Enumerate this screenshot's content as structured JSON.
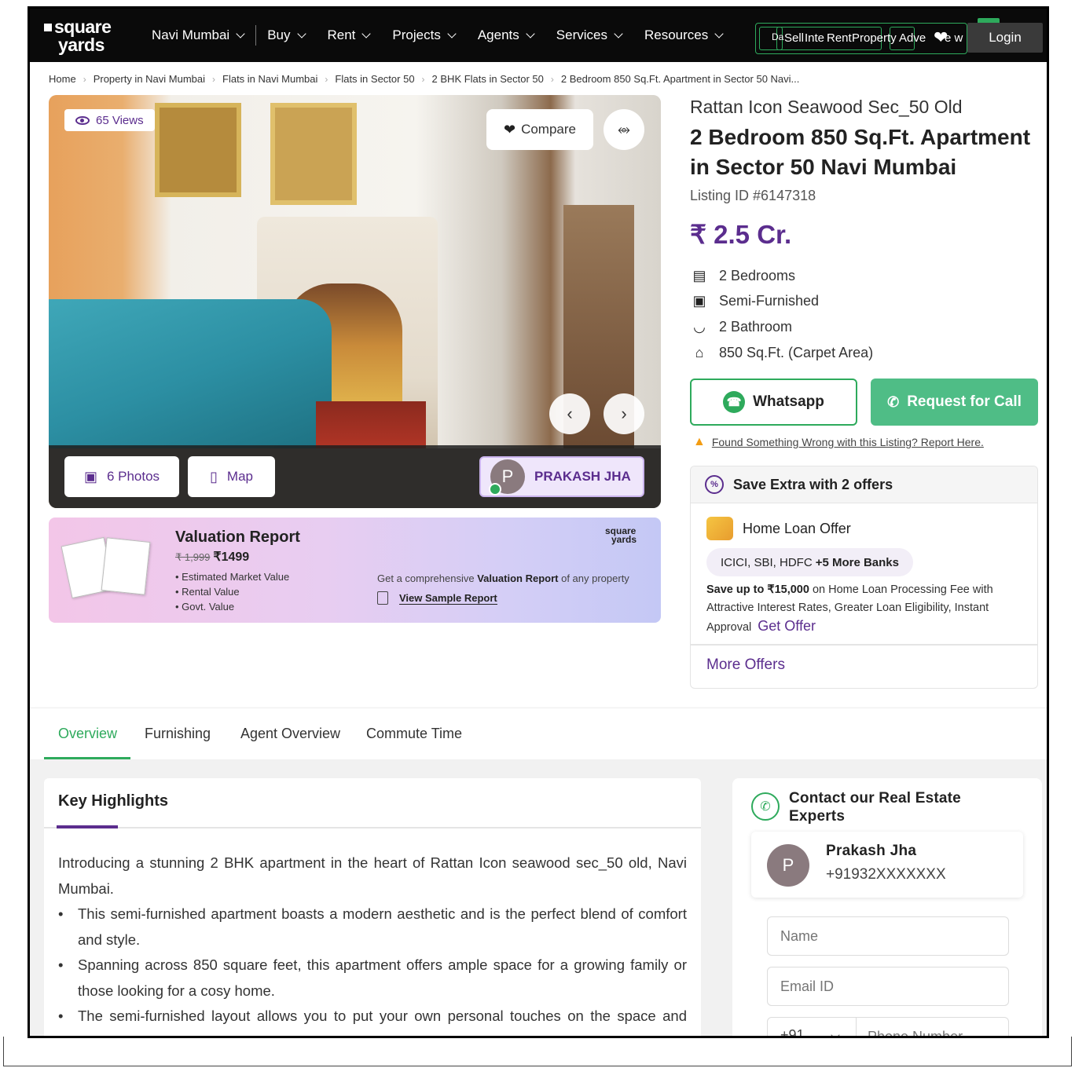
{
  "navbar": {
    "logo_line1": "square",
    "logo_line2": "yards",
    "items": [
      {
        "label": "Navi Mumbai"
      },
      {
        "label": "Buy"
      },
      {
        "label": "Rent"
      },
      {
        "label": "Projects"
      },
      {
        "label": "Agents"
      },
      {
        "label": "Services"
      },
      {
        "label": "Resources"
      }
    ],
    "cluster_labels": [
      "Da",
      "Sell",
      "Inte",
      "Rent",
      "Property",
      "Adve",
      "e w"
    ],
    "login_label": "Login"
  },
  "breadcrumb": [
    "Home",
    "Property in Navi Mumbai",
    "Flats in Navi Mumbai",
    "Flats in Sector 50",
    "2 BHK Flats in Sector 50",
    "2 Bedroom 850 Sq.Ft. Apartment in Sector 50 Navi..."
  ],
  "gallery": {
    "views": "65 Views",
    "compare_label": "Compare",
    "photos_label": "6 Photos",
    "map_label": "Map",
    "agent_initial": "P",
    "agent_name": "PRAKASH JHA"
  },
  "valuation": {
    "title": "Valuation Report",
    "old_price": "₹ 1,999",
    "price": "₹1499",
    "points": [
      "Estimated Market Value",
      "Rental Value",
      "Govt. Value"
    ],
    "desc_pre": "Get a comprehensive ",
    "desc_bold": "Valuation Report",
    "desc_post": " of any property",
    "link": "View Sample Report",
    "brand_line1": "square",
    "brand_line2": "yards"
  },
  "property": {
    "project": "Rattan Icon Seawood Sec_50 Old",
    "title": "2 Bedroom 850 Sq.Ft. Apartment in Sector 50 Navi Mumbai",
    "listing_id": "Listing ID #6147318",
    "price": "₹ 2.5 Cr.",
    "features": [
      {
        "icon": "bed-icon",
        "label": "2 Bedrooms"
      },
      {
        "icon": "sofa-icon",
        "label": "Semi-Furnished"
      },
      {
        "icon": "bathtub-icon",
        "label": "2 Bathroom"
      },
      {
        "icon": "home-icon",
        "label": "850 Sq.Ft. (Carpet Area)"
      }
    ],
    "whatsapp_label": "Whatsapp",
    "call_label": "Request for Call",
    "report_text": "Found Something Wrong with this Listing? Report Here."
  },
  "offers": {
    "heading": "Save Extra with 2 offers",
    "loan_title": "Home Loan Offer",
    "banks": "ICICI, SBI, HDFC",
    "banks_more": "+5 More Banks",
    "desc_bold": "Save up to ₹15,000",
    "desc_rest": " on Home Loan Processing Fee with Attractive Interest Rates, Greater Loan Eligibility, Instant Approval",
    "get_offer": "Get Offer",
    "more_offers": "More Offers"
  },
  "tabs": [
    "Overview",
    "Furnishing",
    "Agent Overview",
    "Commute Time"
  ],
  "highlights": {
    "title": "Key Highlights",
    "intro": "Introducing a stunning 2 BHK apartment in the heart of Rattan Icon seawood sec_50 old, Navi Mumbai.",
    "bullets": [
      "This semi-furnished apartment boasts a modern aesthetic and is the perfect blend of comfort and style.",
      "Spanning across 850 square feet, this apartment offers ample space for a growing family or those looking for a cosy home.",
      "The semi-furnished layout allows you to put your own personal touches on the space and make it"
    ]
  },
  "contact": {
    "title": "Contact our Real Estate Experts",
    "agent_initial": "P",
    "agent_name": "Prakash Jha",
    "agent_phone": "+91932XXXXXXX",
    "name_placeholder": "Name",
    "email_placeholder": "Email ID",
    "country_code": "+91",
    "phone_placeholder": "Phone Number"
  },
  "colors": {
    "accent_purple": "#5b2d8e",
    "accent_green": "#2eaa5c",
    "call_green": "#4fbd86"
  }
}
